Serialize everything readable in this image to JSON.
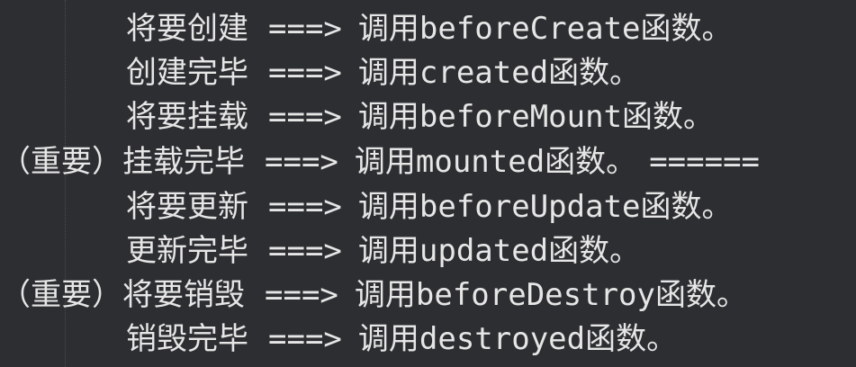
{
  "code_lines": [
    {
      "prefix": "",
      "stage": "将要创建",
      "arrow": "===>",
      "call": "调用beforeCreate函数。",
      "trail": ""
    },
    {
      "prefix": "",
      "stage": "创建完毕",
      "arrow": "===>",
      "call": "调用created函数。",
      "trail": ""
    },
    {
      "prefix": "",
      "stage": "将要挂载",
      "arrow": "===>",
      "call": "调用beforeMount函数。",
      "trail": ""
    },
    {
      "prefix": "（重要）",
      "stage": "挂载完毕",
      "arrow": "===>",
      "call": "调用mounted函数。",
      "trail": "======"
    },
    {
      "prefix": "",
      "stage": "将要更新",
      "arrow": "===>",
      "call": "调用beforeUpdate函数。",
      "trail": ""
    },
    {
      "prefix": "",
      "stage": "更新完毕",
      "arrow": "===>",
      "call": "调用updated函数。",
      "trail": ""
    },
    {
      "prefix": "（重要）",
      "stage": "将要销毁",
      "arrow": "===>",
      "call": "调用beforeDestroy函数。",
      "trail": ""
    },
    {
      "prefix": "",
      "stage": "销毁完毕",
      "arrow": "===>",
      "call": "调用destroyed函数。",
      "trail": ""
    }
  ]
}
